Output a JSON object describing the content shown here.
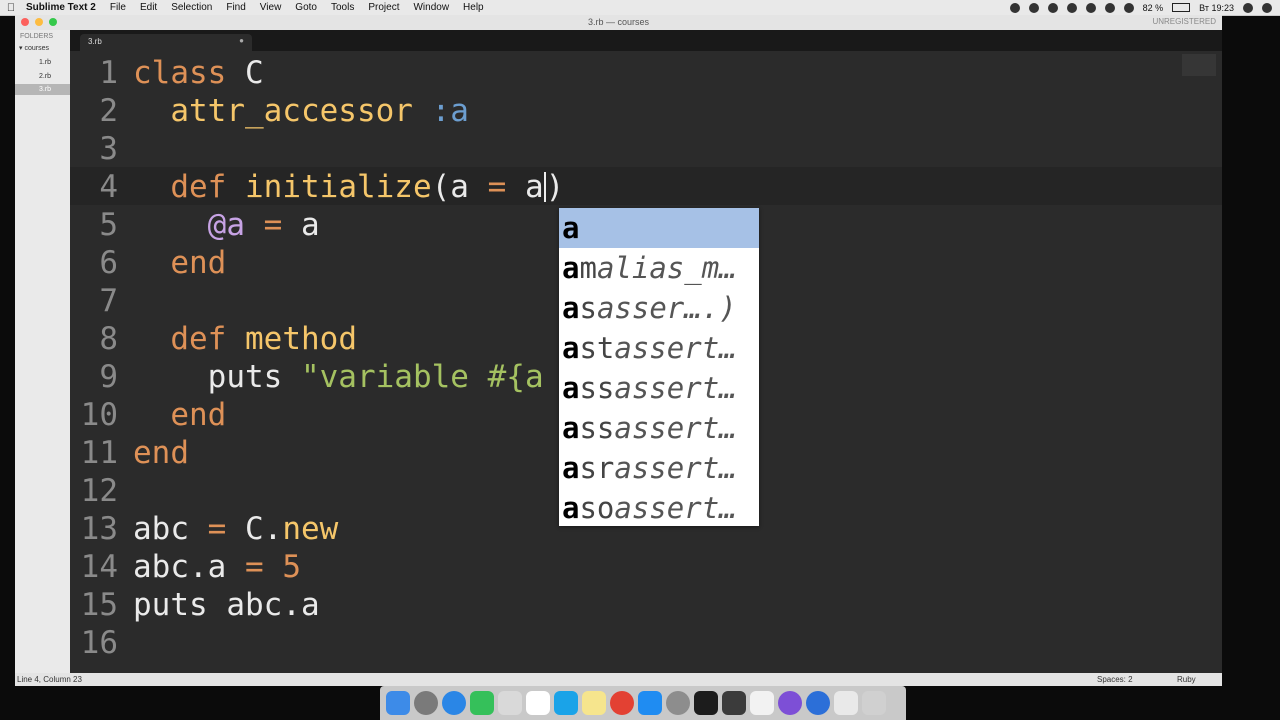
{
  "menubar": {
    "app_name": "Sublime Text 2",
    "items": [
      "File",
      "Edit",
      "Selection",
      "Find",
      "View",
      "Goto",
      "Tools",
      "Project",
      "Window",
      "Help"
    ],
    "battery": "82 %",
    "clock": "Вт 19:23"
  },
  "window": {
    "title": "3.rb — courses",
    "unregistered": "UNREGISTERED"
  },
  "sidebar": {
    "header": "FOLDERS",
    "folder": "courses",
    "files": [
      "1.rb",
      "2.rb",
      "3.rb"
    ],
    "selected": "3.rb"
  },
  "tab": {
    "label": "3.rb"
  },
  "editor": {
    "line_numbers": [
      "1",
      "2",
      "3",
      "4",
      "5",
      "6",
      "7",
      "8",
      "9",
      "10",
      "11",
      "12",
      "13",
      "14",
      "15",
      "16"
    ],
    "current_line": 4
  },
  "autocomplete": {
    "typed": "a",
    "items": [
      {
        "match": "a",
        "rest": "",
        "hint": ""
      },
      {
        "match": "a",
        "rest": "m",
        "hint": "alias_m…"
      },
      {
        "match": "a",
        "rest": "s",
        "hint": "asser….)"
      },
      {
        "match": "a",
        "rest": "st",
        "hint": "assert…"
      },
      {
        "match": "a",
        "rest": "ss",
        "hint": "assert…"
      },
      {
        "match": "a",
        "rest": "ss",
        "hint": "assert…"
      },
      {
        "match": "a",
        "rest": "sr",
        "hint": "assert…"
      },
      {
        "match": "a",
        "rest": "so",
        "hint": "assert…"
      }
    ]
  },
  "statusbar": {
    "position": "Line 4, Column 23",
    "spaces": "Spaces: 2",
    "syntax": "Ruby"
  },
  "colors": {
    "keyword": "#de9157",
    "function": "#f5c66a",
    "symbol": "#6c9ed0",
    "ivar": "#c7a3e5",
    "string": "#a5c261",
    "editor_bg": "#2b2b2b",
    "popup_selected": "#a6c1e6"
  }
}
